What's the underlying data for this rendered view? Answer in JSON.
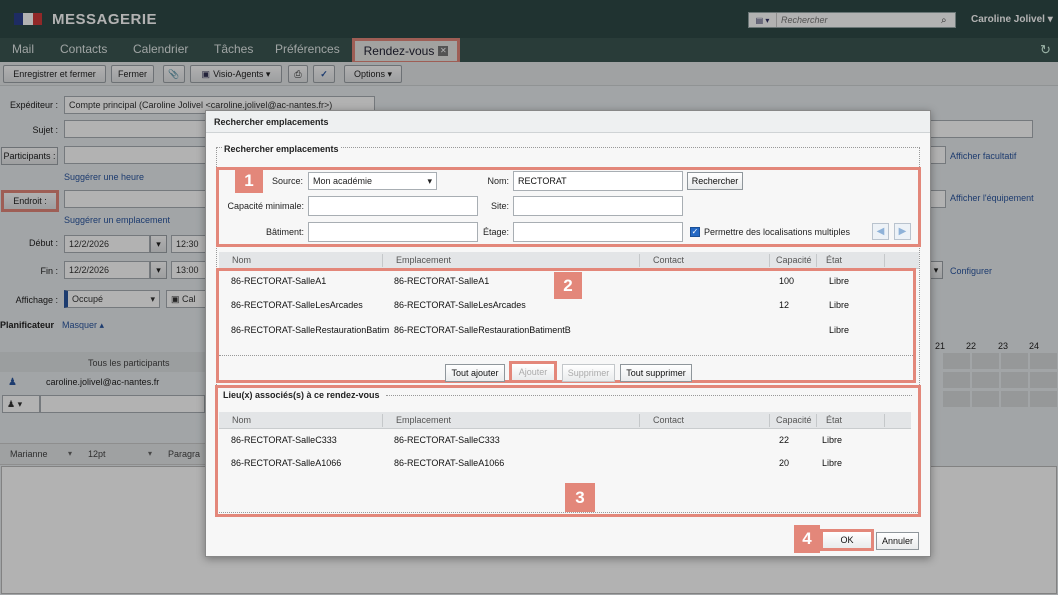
{
  "header": {
    "app_title": "MESSAGERIE",
    "search_placeholder": "Rechercher",
    "user_name": "Caroline Jolivel ▾",
    "flag_colors": [
      "#2b3f8f",
      "#ffffff",
      "#d03a3a"
    ]
  },
  "tabs": [
    {
      "label": "Mail"
    },
    {
      "label": "Contacts"
    },
    {
      "label": "Calendrier"
    },
    {
      "label": "Tâches"
    },
    {
      "label": "Préférences"
    }
  ],
  "active_tab": {
    "label": "Rendez-vous",
    "close_glyph": "✕"
  },
  "toolbar": {
    "save_close": "Enregistrer et fermer",
    "close": "Fermer",
    "attach_icon": "paperclip-icon",
    "visio": "Visio-Agents ▾",
    "print_icon": "print-icon",
    "spell_icon": "spellcheck-icon",
    "options": "Options ▾"
  },
  "form": {
    "sender_label": "Expéditeur :",
    "sender_value": "Compte principal (Caroline Jolivel <caroline.jolivel@ac-nantes.fr>)",
    "subject_label": "Sujet :",
    "participants_label": "Participants :",
    "suggest_time": "Suggérer une heure",
    "location_label": "Endroit :",
    "suggest_location": "Suggérer un emplacement",
    "start_label": "Début :",
    "start_date": "12/2/2026",
    "start_time": "12:30",
    "end_label": "Fin :",
    "end_date": "12/2/2026",
    "end_time": "13:00",
    "display_label": "Affichage :",
    "display_value": "Occupé",
    "show_optional": "Afficher facultatif",
    "show_equipment": "Afficher l'équipement",
    "configure": "Configurer",
    "planner_label": "Planificateur",
    "hide_link": "Masquer ▴",
    "all_participants": "Tous les participants",
    "participant_email": "caroline.jolivel@ac-nantes.fr",
    "hours": [
      "21",
      "22",
      "23",
      "24"
    ],
    "editor_font": "Marianne",
    "editor_size": "12pt",
    "editor_paragraph": "Paragra"
  },
  "dialog": {
    "title": "Rechercher emplacements",
    "legend": "Rechercher emplacements",
    "source_label": "Source:",
    "source_value": "Mon académie",
    "name_label": "Nom:",
    "name_value": "RECTORAT",
    "search_button": "Rechercher",
    "capacity_label": "Capacité minimale:",
    "site_label": "Site:",
    "building_label": "Bâtiment:",
    "floor_label": "Étage:",
    "multi_label": "Permettre des localisations multiples",
    "columns": [
      "Nom",
      "Emplacement",
      "Contact",
      "Capacité",
      "État"
    ],
    "results": [
      {
        "nom": "86-RECTORAT-SalleA1",
        "emplacement": "86-RECTORAT-SalleA1",
        "contact": "",
        "capacite": "100",
        "etat": "Libre"
      },
      {
        "nom": "86-RECTORAT-SalleLesArcades",
        "emplacement": "86-RECTORAT-SalleLesArcades",
        "contact": "",
        "capacite": "12",
        "etat": "Libre"
      },
      {
        "nom": "86-RECTORAT-SalleRestaurationBatim",
        "emplacement": "86-RECTORAT-SalleRestaurationBatimentB",
        "contact": "",
        "capacite": "",
        "etat": "Libre"
      }
    ],
    "add_all": "Tout ajouter",
    "add": "Ajouter",
    "remove": "Supprimer",
    "remove_all": "Tout supprimer",
    "assoc_legend": "Lieu(x) associés(s) à ce rendez-vous",
    "associated": [
      {
        "nom": "86-RECTORAT-SalleC333",
        "emplacement": "86-RECTORAT-SalleC333",
        "contact": "",
        "capacite": "22",
        "etat": "Libre"
      },
      {
        "nom": "86-RECTORAT-SalleA1066",
        "emplacement": "86-RECTORAT-SalleA1066",
        "contact": "",
        "capacite": "20",
        "etat": "Libre"
      }
    ],
    "ok": "OK",
    "cancel": "Annuler"
  },
  "badges": [
    "1",
    "2",
    "3",
    "4"
  ],
  "highlight_color": "#e3877a"
}
